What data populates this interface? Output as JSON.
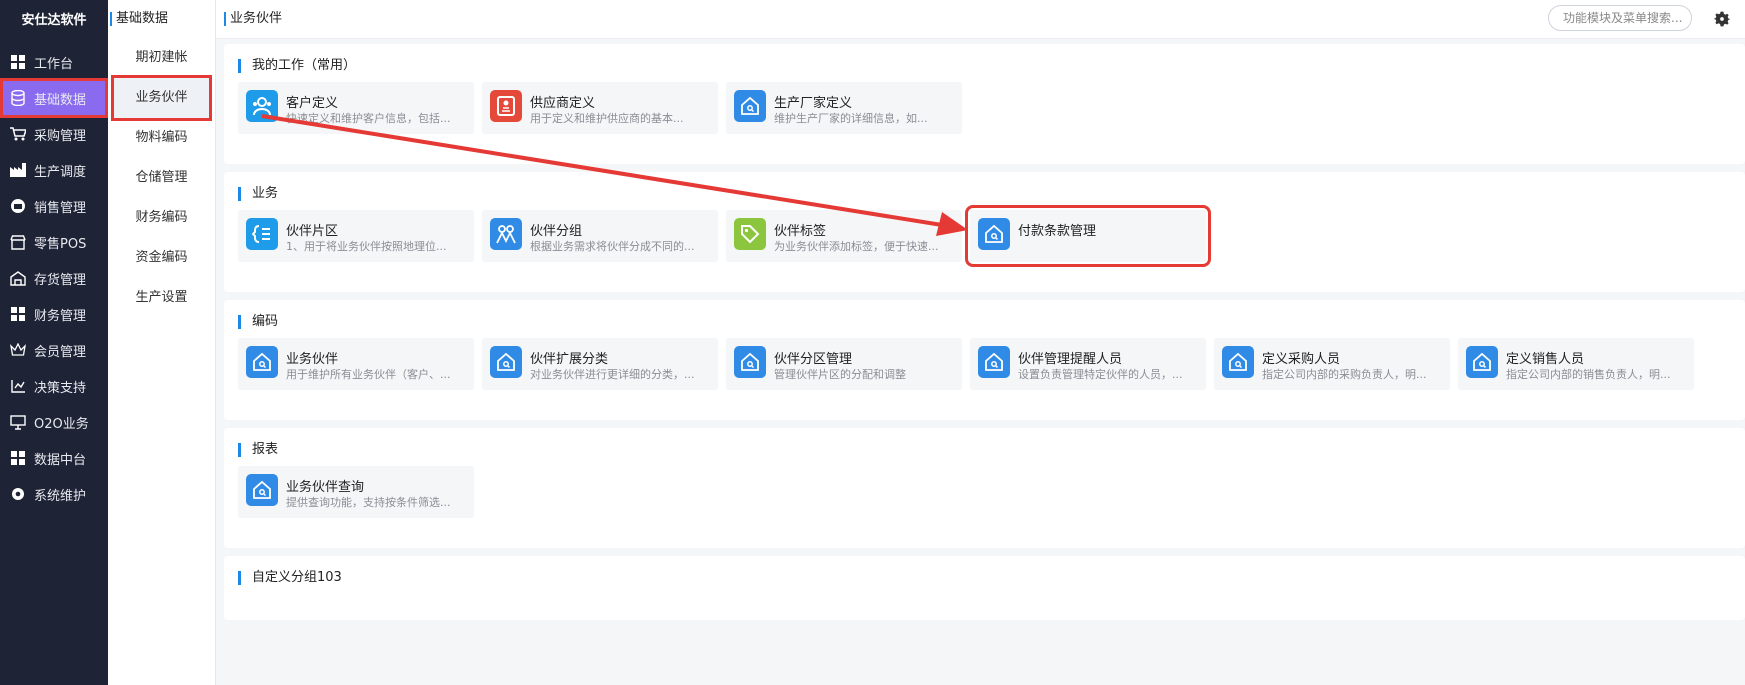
{
  "nav": {
    "brand": "安仕达软件",
    "items": [
      {
        "label": "工作台",
        "icon": "grid-icon"
      },
      {
        "label": "基础数据",
        "icon": "database-icon"
      },
      {
        "label": "采购管理",
        "icon": "cart-icon"
      },
      {
        "label": "生产调度",
        "icon": "factory-icon"
      },
      {
        "label": "销售管理",
        "icon": "sales-icon"
      },
      {
        "label": "零售POS",
        "icon": "shop-icon"
      },
      {
        "label": "存货管理",
        "icon": "warehouse-icon"
      },
      {
        "label": "财务管理",
        "icon": "grid-icon"
      },
      {
        "label": "会员管理",
        "icon": "crown-icon"
      },
      {
        "label": "决策支持",
        "icon": "decision-icon"
      },
      {
        "label": "O2O业务",
        "icon": "monitor-icon"
      },
      {
        "label": "数据中台",
        "icon": "grid-icon"
      },
      {
        "label": "系统维护",
        "icon": "gear-icon"
      }
    ]
  },
  "subnav": {
    "title": "基础数据",
    "items": [
      "期初建帐",
      "业务伙伴",
      "物料编码",
      "仓储管理",
      "财务编码",
      "资金编码",
      "生产设置"
    ]
  },
  "topbar": {
    "breadcrumb": "业务伙伴",
    "search_placeholder": "功能模块及菜单搜索...",
    "settings_icon": "gear-icon"
  },
  "sections": [
    {
      "title": "我的工作（常用）",
      "cards": [
        {
          "name": "客户定义",
          "desc": "快速定义和维护客户信息，包括...",
          "icon": "customer-icon",
          "color": "#1e9be9"
        },
        {
          "name": "供应商定义",
          "desc": "用于定义和维护供应商的基本...",
          "icon": "supplier-icon",
          "color": "#e5493a"
        },
        {
          "name": "生产厂家定义",
          "desc": "维护生产厂家的详细信息，如...",
          "icon": "house-icon",
          "color": "#2f8be6"
        }
      ]
    },
    {
      "title": "业务",
      "cards": [
        {
          "name": "伙伴片区",
          "desc": "1、用于将业务伙伴按照地理位...",
          "icon": "region-icon",
          "color": "#1e9be9"
        },
        {
          "name": "伙伴分组",
          "desc": "根据业务需求将伙伴分成不同的...",
          "icon": "group-icon",
          "color": "#2f8be6"
        },
        {
          "name": "伙伴标签",
          "desc": "为业务伙伴添加标签，便于快速...",
          "icon": "tag-icon",
          "color": "#8cc63f"
        },
        {
          "name": "付款条款管理",
          "desc": "",
          "icon": "house-icon",
          "color": "#2f8be6"
        }
      ]
    },
    {
      "title": "编码",
      "cards": [
        {
          "name": "业务伙伴",
          "desc": "用于维护所有业务伙伴（客户、...",
          "icon": "house-icon",
          "color": "#2f8be6"
        },
        {
          "name": "伙伴扩展分类",
          "desc": "对业务伙伴进行更详细的分类，...",
          "icon": "house-icon",
          "color": "#2f8be6"
        },
        {
          "name": "伙伴分区管理",
          "desc": "管理伙伴片区的分配和调整",
          "icon": "house-icon",
          "color": "#2f8be6"
        },
        {
          "name": "伙伴管理提醒人员",
          "desc": "设置负责管理特定伙伴的人员，...",
          "icon": "house-icon",
          "color": "#2f8be6"
        },
        {
          "name": "定义采购人员",
          "desc": "指定公司内部的采购负责人，明...",
          "icon": "house-icon",
          "color": "#2f8be6"
        },
        {
          "name": "定义销售人员",
          "desc": "指定公司内部的销售负责人，明...",
          "icon": "house-icon",
          "color": "#2f8be6"
        }
      ]
    },
    {
      "title": "报表",
      "cards": [
        {
          "name": "业务伙伴查询",
          "desc": "提供查询功能，支持按条件筛选...",
          "icon": "house-icon",
          "color": "#2f8be6"
        }
      ]
    },
    {
      "title": "自定义分组103",
      "cards": []
    }
  ],
  "colors": {
    "accent": "#1e88e5",
    "nav_bg": "#1f2336",
    "nav_active": "#8a6bf0",
    "highlight": "#e53935"
  }
}
